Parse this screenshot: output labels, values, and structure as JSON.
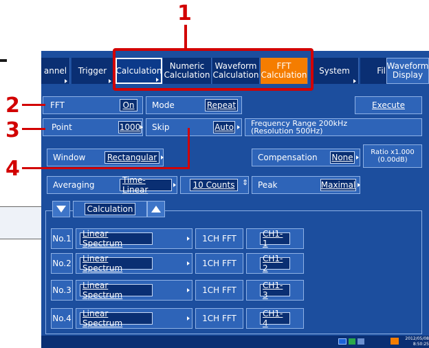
{
  "callouts": {
    "n1": "1",
    "n2": "2",
    "n3": "3",
    "n4": "4"
  },
  "tabs": {
    "channel": "annel",
    "trigger": "Trigger",
    "calculation": "Calculation",
    "numeric_l1": "Numeric",
    "numeric_l2": "Calculation",
    "waveform_l1": "Waveform",
    "waveform_l2": "Calculation",
    "fft_l1": "FFT",
    "fft_l2": "Calculation",
    "system": "System",
    "file": "Fil",
    "display_l1": "Waveform",
    "display_l2": "Display"
  },
  "settings": {
    "fft_label": "FFT",
    "fft_value": "On",
    "mode_label": "Mode",
    "mode_value": "Repeat",
    "execute": "Execute",
    "point_label": "Point",
    "point_value": "1000",
    "skip_label": "Skip",
    "skip_value": "Auto",
    "freq_range_l1": "Frequency Range 200kHz",
    "freq_range_l2": "(Resolution 500Hz)",
    "window_label": "Window",
    "window_value": "Rectangular",
    "compensation_label": "Compensation",
    "compensation_value": "None",
    "ratio_l1": "Ratio x1.000",
    "ratio_l2": "(0.00dB)",
    "averaging_label": "Averaging",
    "averaging_value": "Time-Linear",
    "counts_value": "10 Counts",
    "peak_label": "Peak",
    "peak_value": "Maximal"
  },
  "calc_header": "Calculation",
  "rows": [
    {
      "no": "No.1",
      "func": "Linear Spectrum",
      "type": "1CH FFT",
      "ch": "CH1-1"
    },
    {
      "no": "No.2",
      "func": "Linear Spectrum",
      "type": "1CH FFT",
      "ch": "CH1-2"
    },
    {
      "no": "No.3",
      "func": "Linear Spectrum",
      "type": "1CH FFT",
      "ch": "CH1-3"
    },
    {
      "no": "No.4",
      "func": "Linear Spectrum",
      "type": "1CH FFT",
      "ch": "CH1-4"
    }
  ],
  "status": {
    "date": "2012/05/08",
    "time": "8:50:25"
  },
  "colors": {
    "screen": "#1c4e9e",
    "highlight": "#d20000",
    "active_tab": "#f57d00"
  }
}
